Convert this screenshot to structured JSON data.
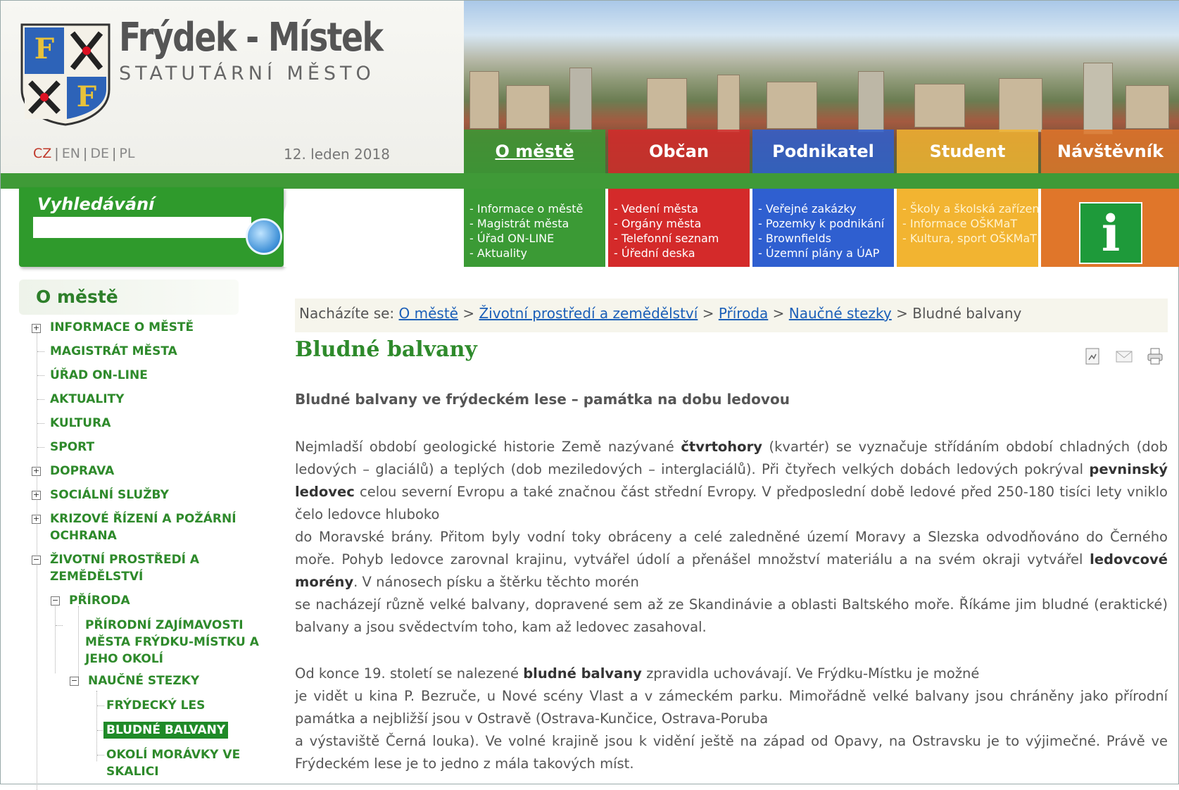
{
  "header": {
    "city_name": "Frýdek - Místek",
    "city_subtitle": "STATUTÁRNÍ MĚSTO",
    "date": "12. leden 2018",
    "languages": [
      "CZ",
      "EN",
      "DE",
      "PL"
    ]
  },
  "nav": [
    {
      "label": "O městě",
      "color": "#3b9a35",
      "items": [
        "- Informace o městě",
        "- Magistrát města",
        "- Úřad ON-LINE",
        "- Aktuality"
      ]
    },
    {
      "label": "Občan",
      "color": "#d42a2a",
      "items": [
        "- Vedení města",
        "- Orgány města",
        "- Telefonní seznam",
        "- Úřední deska"
      ]
    },
    {
      "label": "Podnikatel",
      "color": "#2f5fd0",
      "items": [
        "- Veřejné zakázky",
        "- Pozemky k podnikání",
        "- Brownfields",
        "- Územní plány a ÚAP"
      ]
    },
    {
      "label": "Student",
      "color": "#f2b431",
      "items": [
        "- Školy a školská zařízení",
        "- Informace OŠKMaT",
        "- Kultura, sport OŠKMaT"
      ]
    },
    {
      "label": "Návštěvník",
      "color": "#e0762a",
      "items": []
    }
  ],
  "info_icon": "i",
  "search": {
    "label": "Vyhledávání",
    "placeholder": ""
  },
  "sidebar": {
    "title": "O městě",
    "items": [
      {
        "label": "Informace o městě"
      },
      {
        "label": "Magistrát města"
      },
      {
        "label": "Úřad ON-LINE"
      },
      {
        "label": "Aktuality"
      },
      {
        "label": "Kultura"
      },
      {
        "label": "Sport"
      },
      {
        "label": "Doprava"
      },
      {
        "label": "Sociální služby"
      },
      {
        "label": "Krizové řízení a požární ochrana"
      },
      {
        "label": "Životní prostředí a zemědělství"
      },
      {
        "label": "Příroda"
      },
      {
        "label": "Přírodní zajímavosti města Frýdku-Místku a jeho okolí"
      },
      {
        "label": "Naučné stezky"
      },
      {
        "label": "Frýdecký les"
      },
      {
        "label": "Bludné balvany"
      },
      {
        "label": "Okolí Morávky ve Skalici"
      }
    ]
  },
  "breadcrumb": {
    "prefix": "Nacházíte se:",
    "links": [
      "O městě",
      "Životní prostředí a zemědělství",
      "Příroda",
      "Naučné stezky"
    ],
    "current": "Bludné balvany",
    "sep": ">"
  },
  "page": {
    "title": "Bludné balvany",
    "lead": "Bludné balvany ve frýdeckém lese – památka na dobu ledovou",
    "p1": {
      "t1": "Nejmladší období geologické historie Země nazývané ",
      "b1": "čtvrtohory",
      "t2": " (kvartér) se vyznačuje střídáním období chladných (dob ledových – glaciálů) a teplých (dob meziledových – interglaciálů). Při čtyřech velkých dobách ledových pokrýval ",
      "b2": "pevninský ledovec",
      "t3": " celou severní Evropu a také značnou část střední Evropy. V předposlední době ledové před 250-180 tisíci lety vniklo čelo ledovce hluboko",
      "t4": "do Moravské brány. Přitom byly vodní toky obráceny a celé zaledněné území Moravy a Slezska odvodňováno do Černého moře. Pohyb ledovce zarovnal krajinu, vytvářel údolí a přenášel množství materiálu a na svém okraji vytvářel ",
      "b3": "ledovcové morény",
      "t5": ". V nánosech písku a štěrku těchto morén",
      "t6": "se nacházejí různě velké balvany, dopravené sem až ze Skandinávie a oblasti Baltského moře. Říkáme jim bludné (eraktické) balvany a jsou svědectvím toho, kam až ledovec zasahoval."
    },
    "p2": {
      "t1": "Od konce 19. století se nalezené ",
      "b1": "bludné balvany",
      "t2": " zpravidla uchovávají. Ve Frýdku-Místku je možné",
      "t3": "je vidět u kina P. Bezruče, u Nové scény Vlast a v zámeckém parku. Mimořádně velké balvany jsou chráněny jako přírodní památka a nejbližší jsou v Ostravě (Ostrava-Kunčice, Ostrava-Poruba",
      "t4": "a výstaviště Černá louka). Ve volné krajině jsou k vidění ještě na západ od Opavy, na Ostravsku je to výjimečné. Právě ve Frýdeckém lese je to jedno z mála takových míst."
    }
  }
}
